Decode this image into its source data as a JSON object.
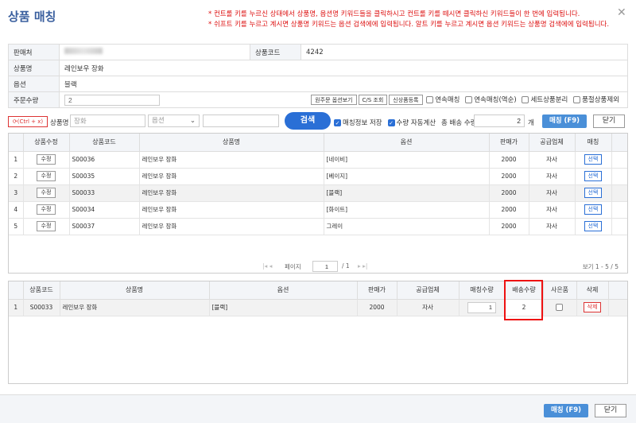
{
  "header": {
    "title": "상품 매칭",
    "notice1": "* 컨트롤 키를 누르신 상태에서 상품명, 옵션명 키워드들을 클릭하시고 컨트롤 키를 떼시면 클릭하신 키워드들이 한 번에 입력됩니다.",
    "notice2": "* 쉬프트 키를 누르고 계시면 상품명 키워드는 옵션 검색에에 입력됩니다. 알트 키를 누르고 계시면 옵션 키워드는 상품명 검색에에 입력됩니다.",
    "close_glyph": "✕"
  },
  "info": {
    "seller_label": "판매처",
    "product_code_label": "상품코드",
    "product_code_value": "4242",
    "product_name_label": "상품명",
    "product_name_value": "레인보우 장화",
    "option_label": "옵션",
    "option_value": "블랙",
    "order_qty_label": "주문수량",
    "order_qty_value": "2",
    "btn_original_option": "원주문 옵션보기",
    "btn_cs": "C/S 조회",
    "btn_new_product": "신상품등록",
    "chk_continuous": "연속매칭",
    "chk_continuous_reverse": "연속매칭(역순)",
    "chk_set_split": "세트상품분리",
    "chk_soldout_exclude": "품절상품제외"
  },
  "search": {
    "reset_label": "(Ctrl + x)",
    "product_name_label": "상품명",
    "product_name_value": "장화",
    "option_select": "옵션",
    "search_btn": "검색",
    "chk_save_match": "매칭정보 저장",
    "chk_auto_qty": "수량 자동계산",
    "total_qty_label": "총 배송 수량",
    "total_qty_value": "2",
    "unit": "개",
    "match_btn": "매칭 (F9)",
    "close_btn": "닫기"
  },
  "results": {
    "headers": [
      "상품수정",
      "상품코드",
      "상품명",
      "옵션",
      "판매가",
      "공급업체",
      "매칭"
    ],
    "edit_label": "수정",
    "select_label": "선택",
    "rows": [
      {
        "no": "1",
        "code": "S00036",
        "name": "레인보우 장화",
        "option": "[네이비]",
        "price": "2000",
        "supplier": "자사"
      },
      {
        "no": "2",
        "code": "S00035",
        "name": "레인보우 장화",
        "option": "[베이지]",
        "price": "2000",
        "supplier": "자사"
      },
      {
        "no": "3",
        "code": "S00033",
        "name": "레인보우 장화",
        "option": "[블랙]",
        "price": "2000",
        "supplier": "자사"
      },
      {
        "no": "4",
        "code": "S00034",
        "name": "레인보우 장화",
        "option": "[화이트]",
        "price": "2000",
        "supplier": "자사"
      },
      {
        "no": "5",
        "code": "S00037",
        "name": "레인보우 장화",
        "option": "그레이",
        "price": "2000",
        "supplier": "자사"
      }
    ]
  },
  "pager": {
    "page_label": "페이지",
    "page_value": "1",
    "total_pages": "/ 1",
    "view_info": "보기 1 - 5 / 5"
  },
  "matched": {
    "headers": [
      "상품코드",
      "상품명",
      "옵션",
      "판매가",
      "공급업체",
      "매칭수량",
      "배송수량",
      "사은품",
      "삭제"
    ],
    "delete_label": "삭제",
    "rows": [
      {
        "no": "1",
        "code": "S00033",
        "name": "레인보우 장화",
        "option": "[블랙]",
        "price": "2000",
        "supplier": "자사",
        "match_qty": "1",
        "ship_qty": "2"
      }
    ]
  },
  "footer": {
    "match_btn": "매칭 (F9)",
    "close_btn": "닫기"
  }
}
